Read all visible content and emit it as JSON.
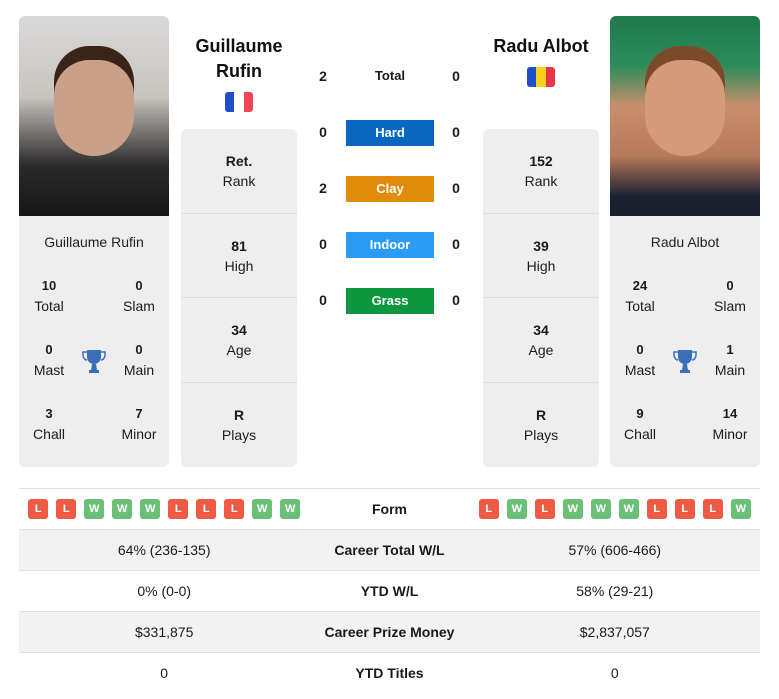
{
  "colors": {
    "hard": "#0868c0",
    "clay": "#e08c0a",
    "indoor": "#2b9bf4",
    "grass": "#0c9640",
    "win": "#6cbf77",
    "loss": "#ee5a44",
    "trophy": "#3a6fb8"
  },
  "player1": {
    "name_line1": "Guillaume",
    "name_line2": "Rufin",
    "card_name": "Guillaume Rufin",
    "flag": "france-flag",
    "titles": {
      "total": "10",
      "total_label": "Total",
      "slam": "0",
      "slam_label": "Slam",
      "mast": "0",
      "mast_label": "Mast",
      "main": "0",
      "main_label": "Main",
      "chall": "3",
      "chall_label": "Chall",
      "minor": "7",
      "minor_label": "Minor"
    },
    "stats": [
      {
        "value": "Ret.",
        "label": "Rank"
      },
      {
        "value": "81",
        "label": "High"
      },
      {
        "value": "34",
        "label": "Age"
      },
      {
        "value": "R",
        "label": "Plays"
      }
    ],
    "form": [
      "L",
      "L",
      "W",
      "W",
      "W",
      "L",
      "L",
      "L",
      "W",
      "W"
    ]
  },
  "player2": {
    "name_line1": "Radu Albot",
    "card_name": "Radu Albot",
    "flag": "moldova-flag",
    "titles": {
      "total": "24",
      "total_label": "Total",
      "slam": "0",
      "slam_label": "Slam",
      "mast": "0",
      "mast_label": "Mast",
      "main": "1",
      "main_label": "Main",
      "chall": "9",
      "chall_label": "Chall",
      "minor": "14",
      "minor_label": "Minor"
    },
    "stats": [
      {
        "value": "152",
        "label": "Rank"
      },
      {
        "value": "39",
        "label": "High"
      },
      {
        "value": "34",
        "label": "Age"
      },
      {
        "value": "R",
        "label": "Plays"
      }
    ],
    "form": [
      "L",
      "W",
      "L",
      "W",
      "W",
      "W",
      "L",
      "L",
      "L",
      "W"
    ]
  },
  "h2h": [
    {
      "label": "Total",
      "p1": "2",
      "p2": "0"
    },
    {
      "label": "Hard",
      "p1": "0",
      "p2": "0"
    },
    {
      "label": "Clay",
      "p1": "2",
      "p2": "0"
    },
    {
      "label": "Indoor",
      "p1": "0",
      "p2": "0"
    },
    {
      "label": "Grass",
      "p1": "0",
      "p2": "0"
    }
  ],
  "comparison": [
    {
      "label": "Form"
    },
    {
      "label": "Career Total W/L",
      "p1": "64% (236-135)",
      "p2": "57% (606-466)"
    },
    {
      "label": "YTD W/L",
      "p1": "0% (0-0)",
      "p2": "58% (29-21)"
    },
    {
      "label": "Career Prize Money",
      "p1": "$331,875",
      "p2": "$2,837,057"
    },
    {
      "label": "YTD Titles",
      "p1": "0",
      "p2": "0"
    }
  ]
}
